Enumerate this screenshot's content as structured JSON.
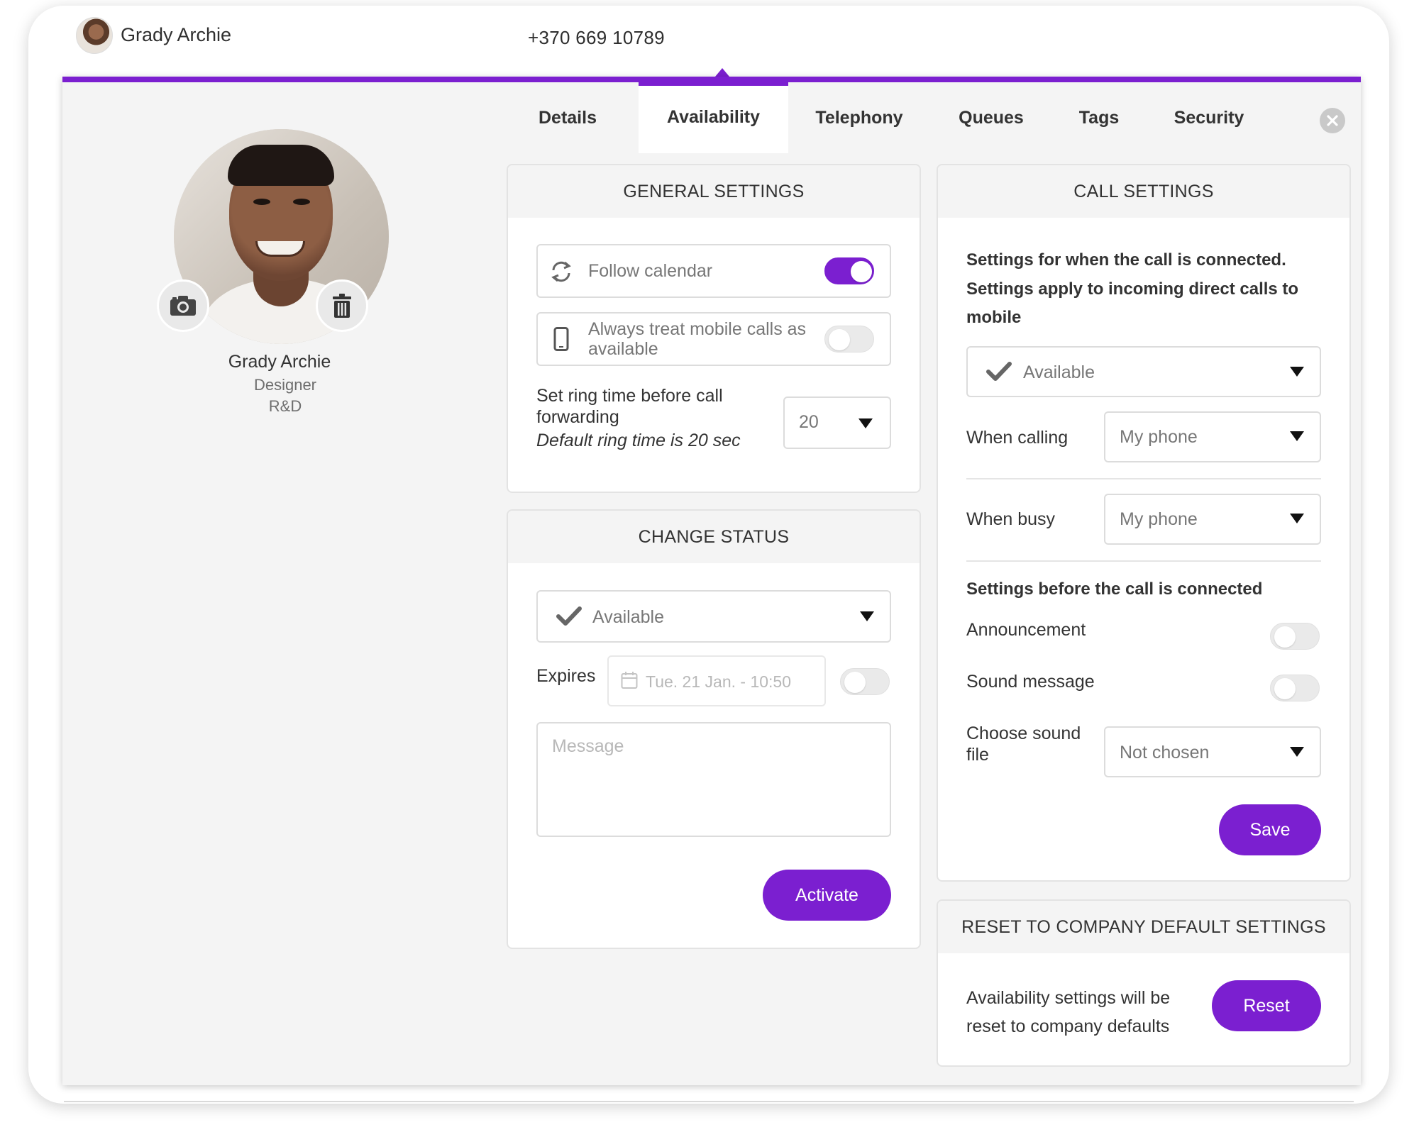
{
  "header": {
    "user_name": "Grady Archie",
    "phone": "+370 669 10789"
  },
  "profile": {
    "name": "Grady Archie",
    "role": "Designer",
    "department": "R&D"
  },
  "tabs": [
    {
      "label": "Details"
    },
    {
      "label": "Availability",
      "active": true
    },
    {
      "label": "Telephony"
    },
    {
      "label": "Queues"
    },
    {
      "label": "Tags"
    },
    {
      "label": "Security"
    }
  ],
  "general_settings": {
    "title": "GENERAL SETTINGS",
    "follow_calendar": {
      "label": "Follow calendar",
      "enabled": true
    },
    "mobile_available": {
      "label_line1": "Always treat mobile calls as",
      "label_line2": "available",
      "enabled": false
    },
    "ring_time": {
      "label_line1": "Set ring time before call",
      "label_line2": "forwarding",
      "hint": "Default ring time is 20 sec",
      "value": "20"
    }
  },
  "change_status": {
    "title": "CHANGE STATUS",
    "status": "Available",
    "expires_label": "Expires",
    "expires_placeholder": "Tue. 21 Jan. - 10:50",
    "expires_enabled": false,
    "message_placeholder": "Message",
    "activate_label": "Activate"
  },
  "call_settings": {
    "title": "CALL SETTINGS",
    "intro_line1": "Settings for when the call is connected.",
    "intro_line2": "Settings apply to incoming direct calls to",
    "intro_line3": "mobile",
    "status": "Available",
    "when_calling_label": "When calling",
    "when_calling_value": "My phone",
    "when_busy_label": "When busy",
    "when_busy_value": "My phone",
    "before_connected_title": "Settings before the call is connected",
    "announcement_label": "Announcement",
    "announcement_enabled": false,
    "sound_message_label": "Sound message",
    "sound_message_enabled": false,
    "sound_file_label_line1": "Choose sound",
    "sound_file_label_line2": "file",
    "sound_file_value": "Not chosen",
    "save_label": "Save"
  },
  "reset": {
    "title": "RESET TO COMPANY DEFAULT SETTINGS",
    "text_line1": "Availability settings will be",
    "text_line2": "reset to company defaults",
    "button_label": "Reset"
  },
  "colors": {
    "accent": "#7b1fd0",
    "pane_bg": "#f4f4f4"
  },
  "icons": [
    "camera-icon",
    "trash-icon",
    "close-icon",
    "sync-icon",
    "mobile-phone-icon",
    "checkmark-icon",
    "calendar-icon",
    "chevron-down-icon"
  ]
}
